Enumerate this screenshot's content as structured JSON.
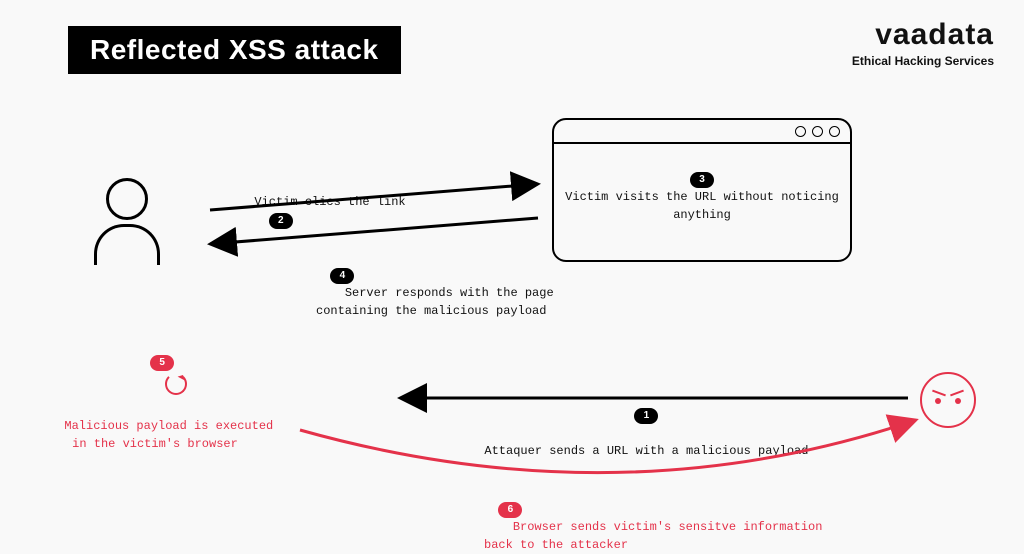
{
  "title": "Reflected XSS attack",
  "brand": {
    "name": "vaadata",
    "tagline": "Ethical Hacking Services"
  },
  "actors": {
    "victim_name": "victim",
    "attacker_name": "attacker",
    "browser_step_badge": "3",
    "browser_text": "Victim visits the URL\nwithout noticing anything"
  },
  "steps": {
    "s1": {
      "badge": "1",
      "text": "Attaquer sends a URL with a malicious payload"
    },
    "s2": {
      "badge": "2",
      "text": "Victim clics the link"
    },
    "s4": {
      "badge": "4",
      "text": "Server responds with the page\ncontaining the malicious payload"
    },
    "s5": {
      "badge": "5",
      "text": "Malicious payload is executed\nin the victim's browser"
    },
    "s6": {
      "badge": "6",
      "text": "Browser sends victim's sensitve information\nback to the attacker"
    }
  }
}
